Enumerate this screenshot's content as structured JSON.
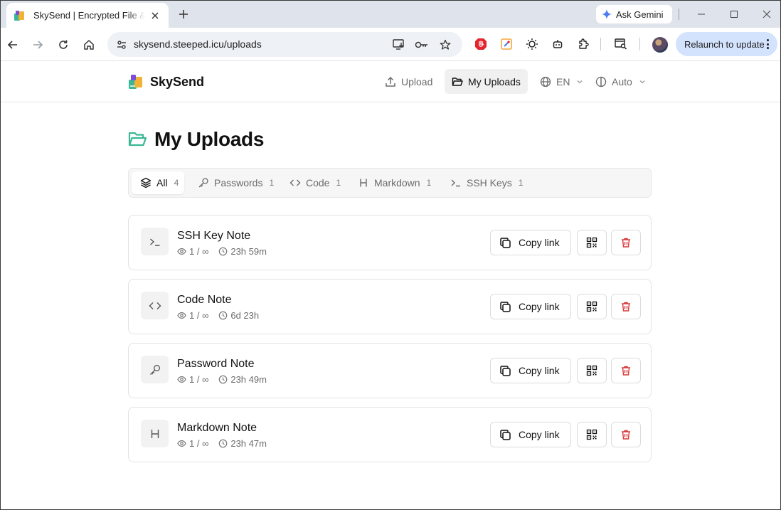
{
  "browser": {
    "tab_title": "SkySend | Encrypted File & Notes",
    "url": "skysend.steeped.icu/uploads",
    "gemini_label": "Ask Gemini",
    "relaunch_label": "Relaunch to update"
  },
  "header": {
    "brand": "SkySend",
    "nav": {
      "upload": "Upload",
      "my_uploads": "My Uploads",
      "language": "EN",
      "theme": "Auto"
    }
  },
  "page": {
    "title": "My Uploads"
  },
  "filters": [
    {
      "label": "All",
      "count": "4",
      "icon": "layers-icon"
    },
    {
      "label": "Passwords",
      "count": "1",
      "icon": "key-icon"
    },
    {
      "label": "Code",
      "count": "1",
      "icon": "code-icon"
    },
    {
      "label": "Markdown",
      "count": "1",
      "icon": "heading-icon"
    },
    {
      "label": "SSH Keys",
      "count": "1",
      "icon": "terminal-icon"
    }
  ],
  "uploads": [
    {
      "title": "SSH Key Note",
      "views": "1 / ∞",
      "expires": "23h 59m",
      "icon": "terminal-icon"
    },
    {
      "title": "Code Note",
      "views": "1 / ∞",
      "expires": "6d 23h",
      "icon": "code-icon"
    },
    {
      "title": "Password Note",
      "views": "1 / ∞",
      "expires": "23h 49m",
      "icon": "key-icon"
    },
    {
      "title": "Markdown Note",
      "views": "1 / ∞",
      "expires": "23h 47m",
      "icon": "heading-icon"
    }
  ],
  "actions": {
    "copy_link": "Copy link"
  },
  "colors": {
    "accent": "#3ab795",
    "danger": "#d93a3a",
    "relaunch_bg": "#d3e3fd"
  }
}
